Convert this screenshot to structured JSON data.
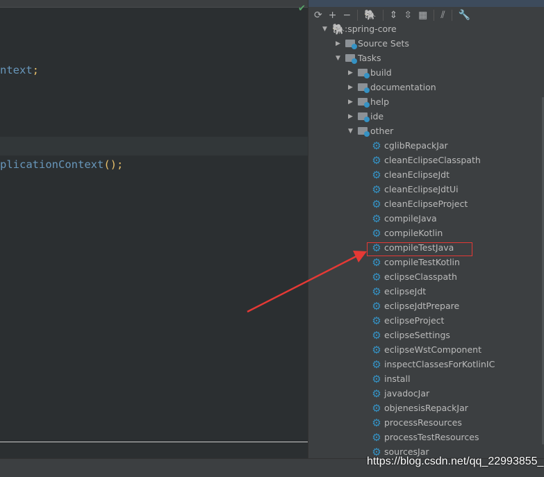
{
  "editor": {
    "line1": {
      "text": "ntext",
      "end": ";"
    },
    "line2": {
      "text": "plicationContext",
      "parens": "()",
      "end": ";"
    }
  },
  "toolbar": {
    "icons": [
      "refresh-icon",
      "add-icon",
      "remove-icon",
      "gradle-elephant-icon",
      "expand-all-icon",
      "collapse-all-icon",
      "source-sets-icon",
      "toggle-offline-icon",
      "wrench-icon"
    ]
  },
  "tree": {
    "root": ":spring-core",
    "source_sets": "Source Sets",
    "tasks": "Tasks",
    "groups": [
      "build",
      "documentation",
      "help",
      "ide",
      "other"
    ],
    "other_tasks": [
      "cglibRepackJar",
      "cleanEclipseClasspath",
      "cleanEclipseJdt",
      "cleanEclipseJdtUi",
      "cleanEclipseProject",
      "compileJava",
      "compileKotlin",
      "compileTestJava",
      "compileTestKotlin",
      "eclipseClasspath",
      "eclipseJdt",
      "eclipseJdtPrepare",
      "eclipseProject",
      "eclipseSettings",
      "eclipseWstComponent",
      "inspectClassesForKotlinIC",
      "install",
      "javadocJar",
      "objenesisRepackJar",
      "processResources",
      "processTestResources",
      "sourcesJar"
    ]
  },
  "highlighted_task": "compileTestJava",
  "watermark": "https://blog.csdn.net/qq_22993855_",
  "colors": {
    "annotation": "#e53935",
    "gear": "#3592c4"
  }
}
